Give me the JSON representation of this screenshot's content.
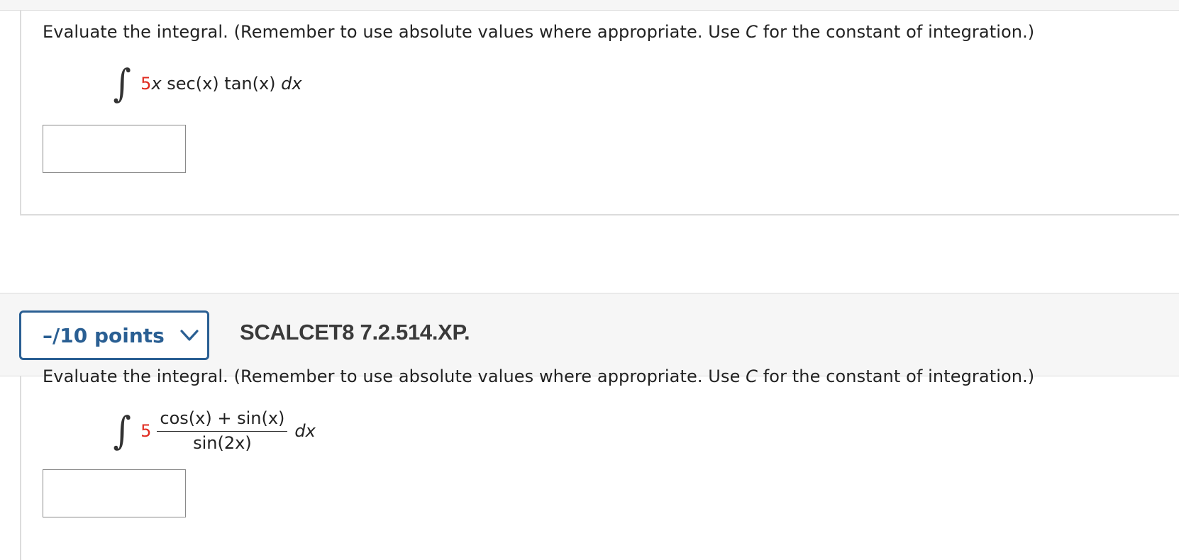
{
  "question1": {
    "prompt_pre": "Evaluate the integral. (Remember to use absolute values where appropriate. Use ",
    "prompt_var": "C",
    "prompt_post": " for the constant of integration.)",
    "coefficient": "5",
    "var": "x",
    "expr_rest": " sec(x) tan(x) ",
    "dx": "dx",
    "answer_value": ""
  },
  "question2_header": {
    "points_label": "–/10 points",
    "question_id": "SCALCET8 7.2.514.XP."
  },
  "question2": {
    "prompt_pre": "Evaluate the integral. (Remember to use absolute values where appropriate. Use ",
    "prompt_var": "C",
    "prompt_post": " for the constant of integration.)",
    "coefficient": "5",
    "numerator": "cos(x) + sin(x)",
    "denominator": "sin(2x)",
    "dx": "dx",
    "answer_value": ""
  },
  "colors": {
    "accent": "#2a5f93",
    "highlight": "#e02b20"
  }
}
